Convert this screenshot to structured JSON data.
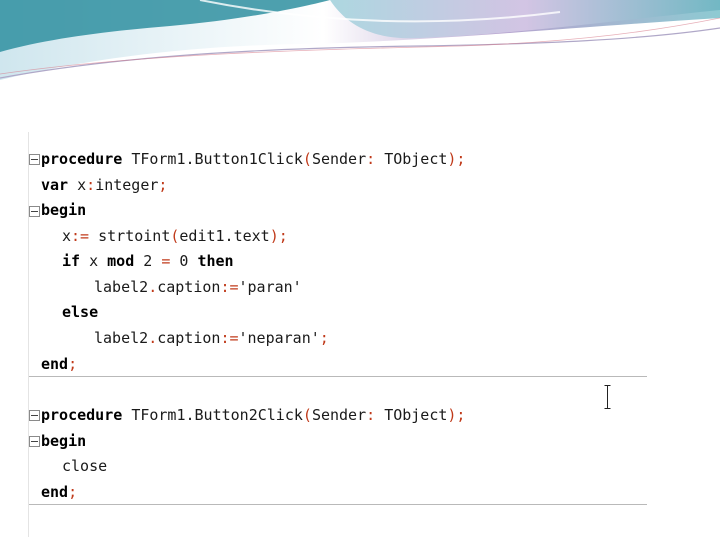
{
  "editor": {
    "block1": {
      "line1": {
        "kw": "procedure",
        "name": "TForm1.Button1Click",
        "open": "(",
        "param": "Sender",
        "colon": ":",
        "type": "TObject",
        "close": ");"
      },
      "line2": {
        "kw": "var",
        "text": "x",
        "colon": ":",
        "type": "integer",
        "semi": ";"
      },
      "line3": {
        "kw": "begin"
      },
      "line4": {
        "lhs": "x",
        "assign": ":=",
        "fn": "strtoint",
        "open": "(",
        "arg": "edit1.text",
        "close": ");"
      },
      "line5": {
        "kw_if": "if",
        "x": "x",
        "kw_mod": "mod",
        "num1": "2",
        "eq": "=",
        "num2": "0",
        "kw_then": "then"
      },
      "line6": {
        "obj": "label2",
        "dot": ".",
        "prop": "caption",
        "assign": ":=",
        "str": "'paran'"
      },
      "line7": {
        "kw": "else"
      },
      "line8": {
        "obj": "label2",
        "dot": ".",
        "prop": "caption",
        "assign": ":=",
        "str": "'neparan'",
        "semi": ";"
      },
      "line9": {
        "kw": "end",
        "semi": ";"
      }
    },
    "block2": {
      "line1": {
        "kw": "procedure",
        "name": "TForm1.Button2Click",
        "open": "(",
        "param": "Sender",
        "colon": ":",
        "type": "TObject",
        "close": ");"
      },
      "line2": {
        "kw": "begin"
      },
      "line3": {
        "text": "close"
      },
      "line4": {
        "kw": "end",
        "semi": ";"
      }
    }
  }
}
